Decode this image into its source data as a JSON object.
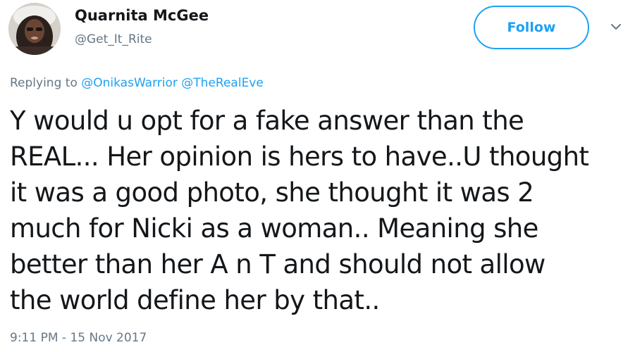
{
  "author": {
    "name": "Quarnita McGee",
    "handle": "@Get_It_Rite"
  },
  "follow_button": {
    "label": "Follow"
  },
  "reply": {
    "prefix": "Replying to",
    "mentions": [
      "@OnikasWarrior",
      "@TheRealEve"
    ]
  },
  "tweet": {
    "lines": [
      "Y would u opt for a fake answer than the",
      "REAL... Her opinion is hers to have..U thought",
      "it was a good photo, she thought it was 2",
      "much for Nicki as a woman.. Meaning she",
      "better than her A n T and should not allow",
      "the world define her by that.."
    ]
  },
  "timestamp": "9:11 PM - 15 Nov 2017",
  "colors": {
    "accent": "#1da1f2",
    "muted": "#657786",
    "text": "#14171a"
  },
  "icons": {
    "menu": "chevron-down-icon"
  }
}
